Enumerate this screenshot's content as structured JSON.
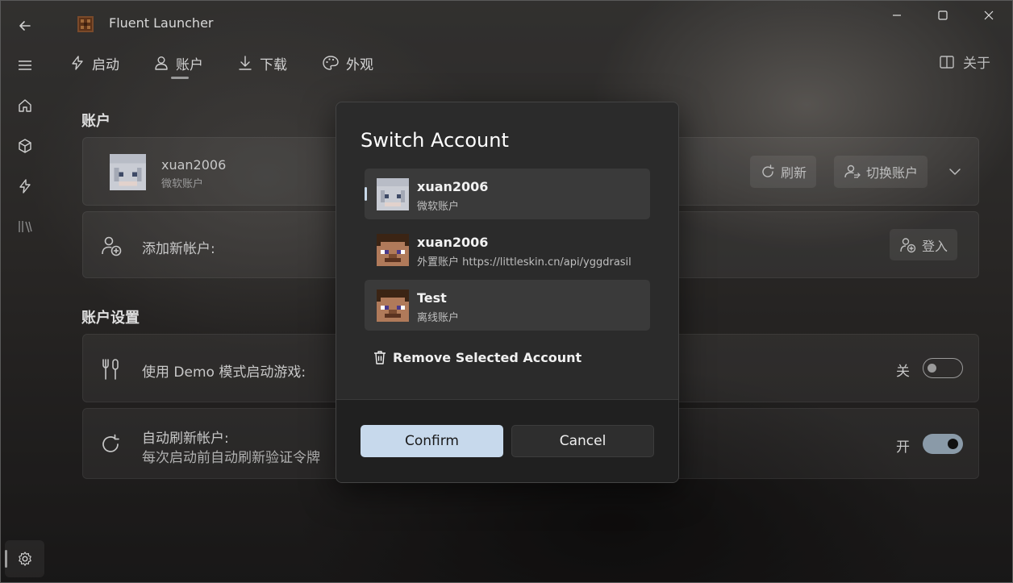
{
  "window": {
    "title": "Fluent Launcher",
    "controls": [
      "minimize",
      "maximize",
      "close"
    ]
  },
  "nav": {
    "items": [
      {
        "label": "启动",
        "icon": "lightning-icon"
      },
      {
        "label": "账户",
        "icon": "person-icon",
        "active": true
      },
      {
        "label": "下载",
        "icon": "download-icon"
      },
      {
        "label": "外观",
        "icon": "palette-icon"
      }
    ],
    "about_label": "关于"
  },
  "rail": {
    "items": [
      "menu-icon",
      "home-icon",
      "cube-icon",
      "lightning-icon",
      "library-icon"
    ],
    "settings": "gear-icon"
  },
  "accounts_section": {
    "title": "账户",
    "current": {
      "name": "xuan2006",
      "type": "微软账户"
    },
    "refresh_label": "刷新",
    "switch_label": "切换账户",
    "add_label": "添加新帐户:",
    "login_label": "登入"
  },
  "settings_section": {
    "title": "账户设置",
    "demo": {
      "label": "使用 Demo 模式启动游戏:",
      "state_label": "关",
      "on": false
    },
    "auto_refresh": {
      "label": "自动刷新帐户:",
      "desc": "每次启动前自动刷新验证令牌",
      "state_label": "开",
      "on": true
    }
  },
  "dialog": {
    "title": "Switch Account",
    "accounts": [
      {
        "name": "xuan2006",
        "type": "微软账户",
        "selected": true
      },
      {
        "name": "xuan2006",
        "type": "外置账户 https://littleskin.cn/api/yggdrasil",
        "selected": false
      },
      {
        "name": "Test",
        "type": "离线账户",
        "selected": false
      }
    ],
    "remove_label": "Remove Selected Account",
    "confirm_label": "Confirm",
    "cancel_label": "Cancel"
  },
  "colors": {
    "accent": "#c7d9ec",
    "dialog_bg": "#2b2b2b",
    "toggle_on": "#8a9aa8"
  }
}
